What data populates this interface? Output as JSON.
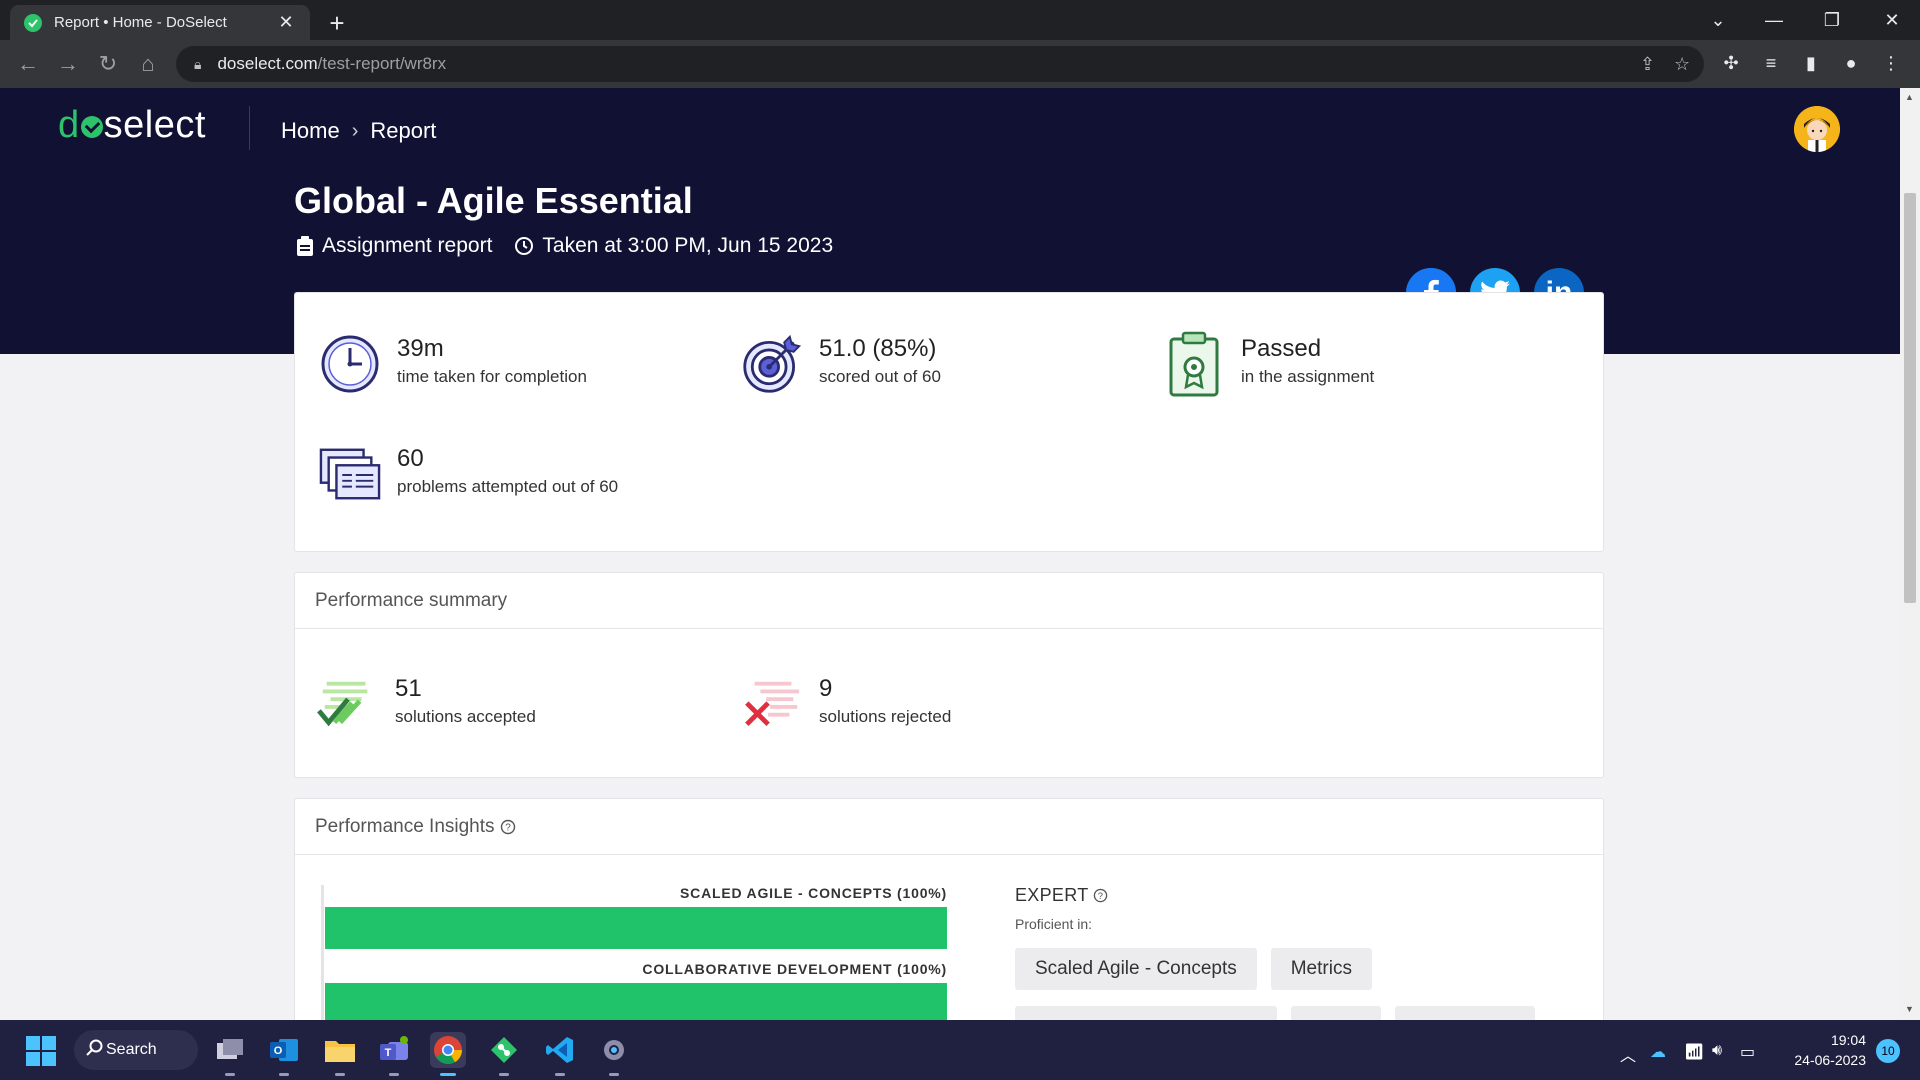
{
  "browser": {
    "tab_title": "Report • Home - DoSelect",
    "url_host": "doselect.com",
    "url_path": "/test-report/wr8rx"
  },
  "header": {
    "logo_text": "doselect",
    "breadcrumb": [
      "Home",
      "Report"
    ]
  },
  "test": {
    "title": "Global - Agile Essential",
    "type": "Assignment report",
    "taken_at": "Taken at 3:00 PM, Jun 15 2023"
  },
  "social": [
    "facebook-icon",
    "twitter-icon",
    "linkedin-icon"
  ],
  "summary_stats": [
    {
      "value": "39m",
      "label": "time taken for completion",
      "icon": "clock-icon"
    },
    {
      "value": "51.0 (85%)",
      "label": "scored out of 60",
      "icon": "target-icon"
    },
    {
      "value": "Passed",
      "label": "in the assignment",
      "icon": "certificate-icon"
    },
    {
      "value": "60",
      "label": "problems attempted out of 60",
      "icon": "documents-icon"
    }
  ],
  "performance_summary": {
    "title": "Performance summary",
    "accepted": {
      "value": "51",
      "label": "solutions accepted"
    },
    "rejected": {
      "value": "9",
      "label": "solutions rejected"
    }
  },
  "insights": {
    "title": "Performance Insights",
    "level": "EXPERT",
    "proficient_label": "Proficient in:",
    "tags": [
      "Scaled Agile - Concepts",
      "Metrics"
    ]
  },
  "chart_data": {
    "type": "bar",
    "orientation": "horizontal",
    "categories": [
      "SCALED AGILE - CONCEPTS (100%)",
      "COLLABORATIVE DEVELOPMENT (100%)"
    ],
    "values": [
      100,
      100
    ],
    "xlim": [
      0,
      100
    ],
    "colors": [
      "#21c36a"
    ]
  },
  "taskbar": {
    "search_label": "Search",
    "time": "19:04",
    "date": "24-06-2023",
    "notifications": "10"
  },
  "colors": {
    "header_bg": "#111133",
    "brand_green": "#2dc36a",
    "bar_green": "#21c36a"
  }
}
